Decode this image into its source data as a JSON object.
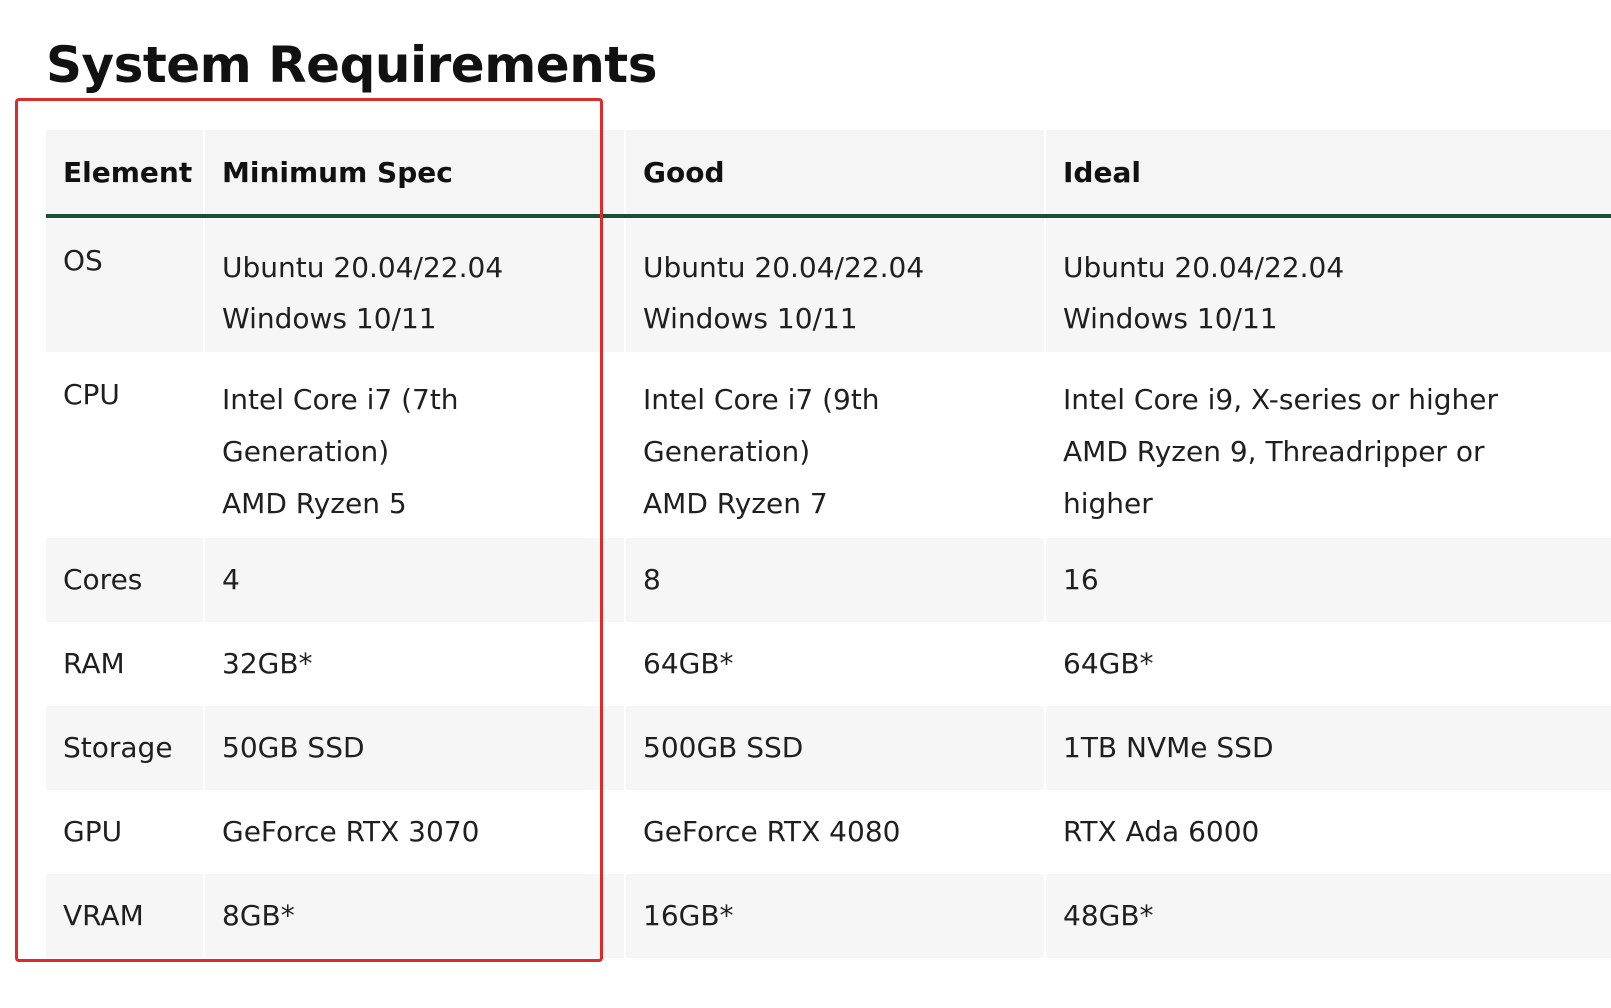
{
  "page": {
    "title": "System Requirements"
  },
  "table": {
    "headers": [
      "Element",
      "Minimum Spec",
      "Good",
      "Ideal"
    ],
    "rows": [
      {
        "element": "OS",
        "minimum": [
          "Ubuntu 20.04/22.04",
          "Windows 10/11"
        ],
        "good": [
          "Ubuntu 20.04/22.04",
          "Windows 10/11"
        ],
        "ideal": [
          "Ubuntu 20.04/22.04",
          "Windows 10/11"
        ]
      },
      {
        "element": "CPU",
        "minimum": [
          "Intel Core i7 (7th",
          "Generation)",
          "AMD Ryzen 5"
        ],
        "good": [
          "Intel Core i7 (9th",
          "Generation)",
          "AMD Ryzen 7"
        ],
        "ideal": [
          "Intel Core i9, X-series or higher",
          "AMD Ryzen 9, Threadripper or",
          "higher"
        ]
      },
      {
        "element": "Cores",
        "minimum": [
          "4"
        ],
        "good": [
          "8"
        ],
        "ideal": [
          "16"
        ]
      },
      {
        "element": "RAM",
        "minimum": [
          "32GB*"
        ],
        "good": [
          "64GB*"
        ],
        "ideal": [
          "64GB*"
        ]
      },
      {
        "element": "Storage",
        "minimum": [
          "50GB SSD"
        ],
        "good": [
          "500GB SSD"
        ],
        "ideal": [
          "1TB NVMe SSD"
        ]
      },
      {
        "element": "GPU",
        "minimum": [
          "GeForce RTX 3070"
        ],
        "good": [
          "GeForce RTX 4080"
        ],
        "ideal": [
          "RTX Ada 6000"
        ]
      },
      {
        "element": "VRAM",
        "minimum": [
          "8GB*"
        ],
        "good": [
          "16GB*"
        ],
        "ideal": [
          "48GB*"
        ]
      }
    ]
  },
  "colors": {
    "header_rule": "#1e4d36",
    "highlight_box": "#dd2b2b",
    "row_shade": "#f6f6f6"
  }
}
